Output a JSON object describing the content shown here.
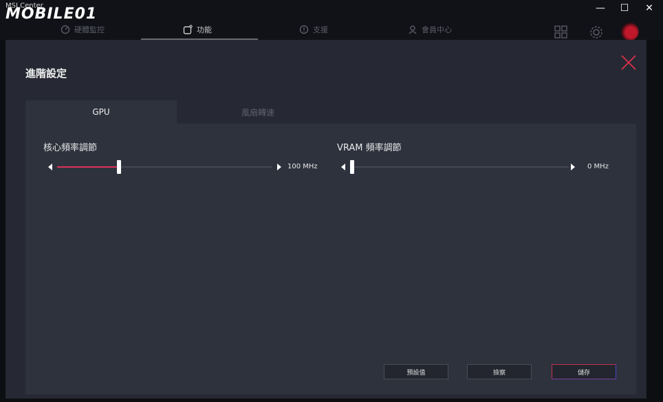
{
  "app": {
    "title": "MSI Center",
    "watermark": "MOBILE01"
  },
  "window_controls": {
    "minimize": "—",
    "maximize": "☐",
    "close": "✕"
  },
  "nav": {
    "tabs": [
      {
        "label": "硬體監控",
        "icon": "gauge-icon"
      },
      {
        "label": "功能",
        "icon": "feature-icon",
        "active": true
      },
      {
        "label": "支援",
        "icon": "support-icon"
      },
      {
        "label": "會員中心",
        "icon": "member-icon"
      }
    ],
    "icons": [
      "grid-icon",
      "gear-icon",
      "avatar"
    ]
  },
  "page": {
    "title": "進階設定",
    "tabs": [
      {
        "label": "GPU",
        "active": true
      },
      {
        "label": "風扇轉速",
        "active": false
      }
    ]
  },
  "sliders": {
    "core": {
      "label": "核心頻率調節",
      "value_text": "100 MHz",
      "fraction": 0.29
    },
    "vram": {
      "label": "VRAM 頻率調節",
      "value_text": "0 MHz",
      "fraction": 0.0
    }
  },
  "buttons": {
    "default": "預設值",
    "reset": "撿察",
    "save": "儲存"
  },
  "colors": {
    "accent": "#e0305a",
    "panel": "#262933",
    "content": "#2e323d"
  }
}
